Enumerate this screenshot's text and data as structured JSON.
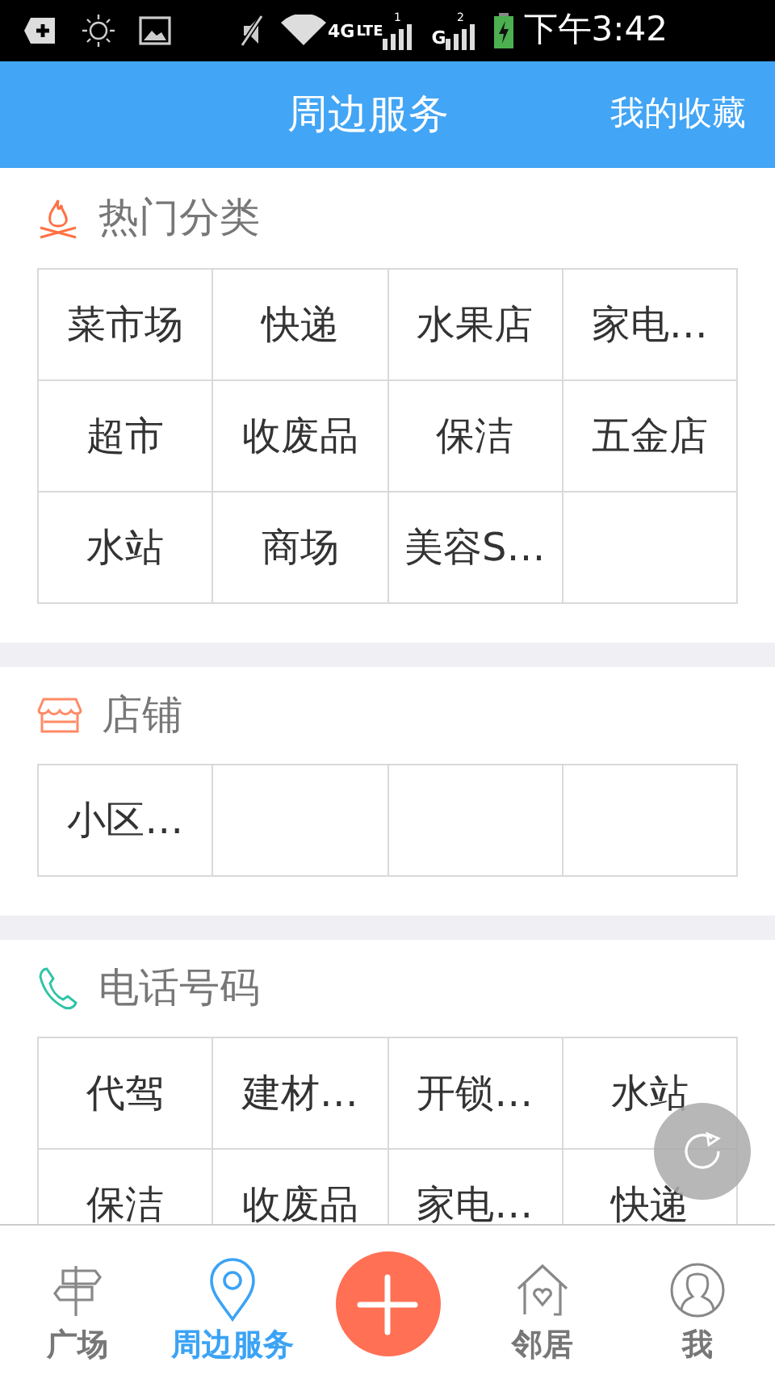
{
  "status_bar": {
    "network_1": "4G",
    "network_1_sub": "LTE",
    "sim_1": "1",
    "network_2": "G",
    "sim_2": "2",
    "time": "下午3:42"
  },
  "header": {
    "title": "周边服务",
    "action": "我的收藏"
  },
  "sections": [
    {
      "kind": "fire",
      "title": "热门分类",
      "cells": [
        "菜市场",
        "快递",
        "水果店",
        "家电…",
        "超市",
        "收废品",
        "保洁",
        "五金店",
        "水站",
        "商场",
        "美容S…"
      ]
    },
    {
      "kind": "shop",
      "title": "店铺",
      "cells": [
        "小区…"
      ]
    },
    {
      "kind": "phone",
      "title": "电话号码",
      "cells": [
        "代驾",
        "建材…",
        "开锁…",
        "水站",
        "保洁",
        "收废品",
        "家电…",
        "快递"
      ]
    }
  ],
  "bottom_nav": [
    {
      "kind": "signpost",
      "label": "广场",
      "selected": false
    },
    {
      "kind": "pin",
      "label": "周边服务",
      "selected": true
    },
    {
      "kind": "add"
    },
    {
      "kind": "house",
      "label": "邻居",
      "selected": false
    },
    {
      "kind": "person",
      "label": "我",
      "selected": false
    }
  ]
}
